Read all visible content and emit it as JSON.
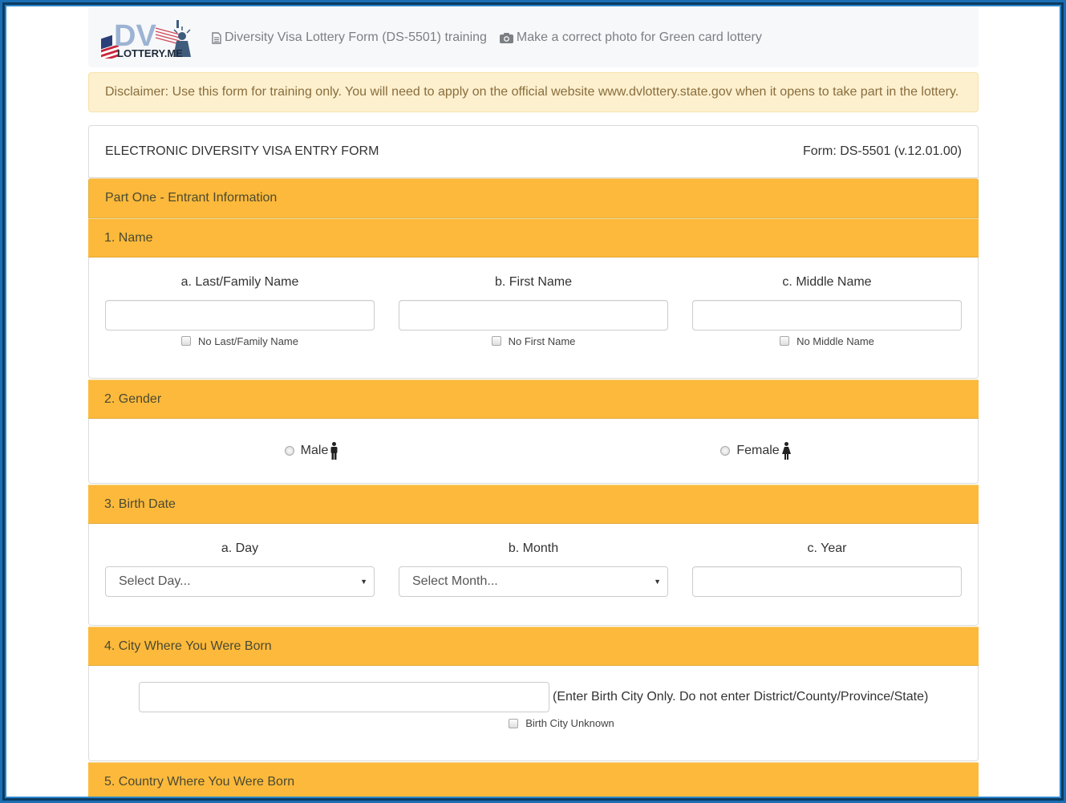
{
  "navbar": {
    "logo_alt": "DV LOTTERY.ME",
    "logo_text_big": "DV",
    "logo_text_small": "LOTTERY.ME",
    "links": [
      {
        "icon": "document-icon",
        "label": "Diversity Visa Lottery Form (DS-5501) training"
      },
      {
        "icon": "camera-icon",
        "label": "Make a correct photo for Green card lottery"
      }
    ]
  },
  "alert": {
    "text": "Disclaimer: Use this form for training only. You will need to apply on the official website www.dvlottery.state.gov when it opens to take part in the lottery."
  },
  "form_header": {
    "title": "ELECTRONIC DIVERSITY VISA ENTRY FORM",
    "form_id": "Form: DS-5501 (v.12.01.00)"
  },
  "part_one": {
    "title": "Part One - Entrant Information"
  },
  "sections": {
    "name": {
      "title": "1. Name",
      "fields": [
        {
          "label": "a. Last/Family Name",
          "value": "",
          "checkbox_label": "No Last/Family Name",
          "checked": false
        },
        {
          "label": "b. First Name",
          "value": "",
          "checkbox_label": "No First Name",
          "checked": false
        },
        {
          "label": "c. Middle Name",
          "value": "",
          "checkbox_label": "No Middle Name",
          "checked": false
        }
      ]
    },
    "gender": {
      "title": "2. Gender",
      "options": [
        {
          "label": "Male",
          "icon": "male-icon",
          "selected": false
        },
        {
          "label": "Female",
          "icon": "female-icon",
          "selected": false
        }
      ]
    },
    "birth_date": {
      "title": "3. Birth Date",
      "day": {
        "label": "a. Day",
        "selected": "Select Day..."
      },
      "month": {
        "label": "b. Month",
        "selected": "Select Month..."
      },
      "year": {
        "label": "c. Year",
        "value": ""
      }
    },
    "birth_city": {
      "title": "4. City Where You Were Born",
      "value": "",
      "hint": "(Enter Birth City Only. Do not enter District/County/Province/State)",
      "checkbox_label": "Birth City Unknown",
      "checked": false
    },
    "birth_country": {
      "title": "5. Country Where You Were Born"
    }
  },
  "colors": {
    "section_header": "#fdb93b",
    "alert_bg": "#fcf0cf",
    "alert_text": "#8a6d3b",
    "frame_border": "#1a6fb5"
  }
}
